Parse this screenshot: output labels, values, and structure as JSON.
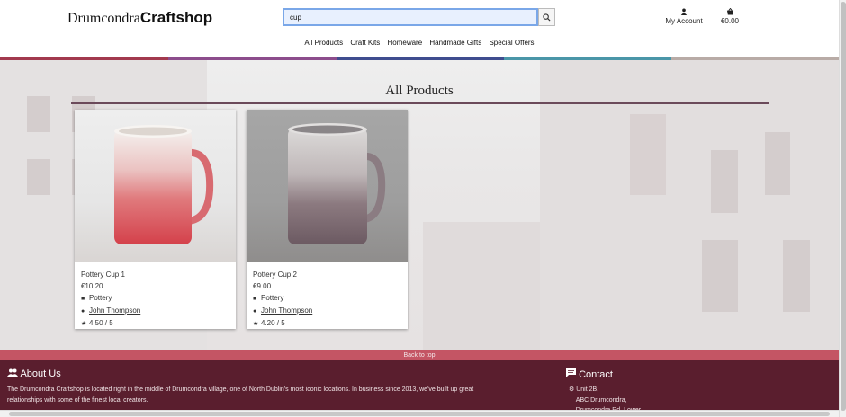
{
  "header": {
    "logo_regular": "Drumcondra",
    "logo_bold": "Craftshop",
    "search_value": "cup",
    "account_label": "My Account",
    "cart_total": "€0.00"
  },
  "nav": [
    "All Products",
    "Craft Kits",
    "Homeware",
    "Handmade Gifts",
    "Special Offers"
  ],
  "stripe_colors": [
    "#a2394e",
    "#8c4d8c",
    "#3f4d8f",
    "#4a96a8",
    "#b8aba6"
  ],
  "page_title": "All Products",
  "products": [
    {
      "name": "Pottery Cup 1",
      "price": "€10.20",
      "category": "Pottery",
      "seller": "John Thompson",
      "rating": "4.50 / 5"
    },
    {
      "name": "Pottery Cup 2",
      "price": "€9.00",
      "category": "Pottery",
      "seller": "John Thompson",
      "rating": "4.20 / 5"
    }
  ],
  "back_to_top": "Back to top",
  "footer": {
    "about_title": "About Us",
    "about_text_1": "The Drumcondra Craftshop is located right in the middle of Drumcondra village, one of North Dublin's most iconic locations. In business since 2013, we've built up great",
    "about_text_2": "relationships with some of the finest local creators.",
    "contact_title": "Contact",
    "address_1": "Unit 2B,",
    "address_2": "ABC Drumcondra,",
    "address_3": "Drumcondra Rd. Lower"
  }
}
